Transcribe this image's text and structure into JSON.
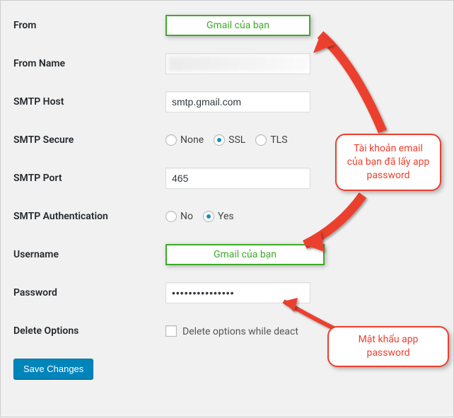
{
  "labels": {
    "from": "From",
    "from_name": "From Name",
    "smtp_host": "SMTP Host",
    "smtp_secure": "SMTP Secure",
    "smtp_port": "SMTP Port",
    "smtp_auth": "SMTP Authentication",
    "username": "Username",
    "password": "Password",
    "delete_options": "Delete Options"
  },
  "values": {
    "from_highlight": "Gmail của bạn",
    "smtp_host": "smtp.gmail.com",
    "smtp_port": "465",
    "username_highlight": "Gmail của bạn",
    "password": "•••••••••••••••"
  },
  "radios": {
    "secure_none": "None",
    "secure_ssl": "SSL",
    "secure_tls": "TLS",
    "auth_no": "No",
    "auth_yes": "Yes"
  },
  "delete_checkbox_label": "Delete options while deact",
  "save_btn": "Save Changes",
  "callouts": {
    "email": "Tài khoản email của bạn đã lấy app password",
    "password": "Mật khẩu app password"
  }
}
